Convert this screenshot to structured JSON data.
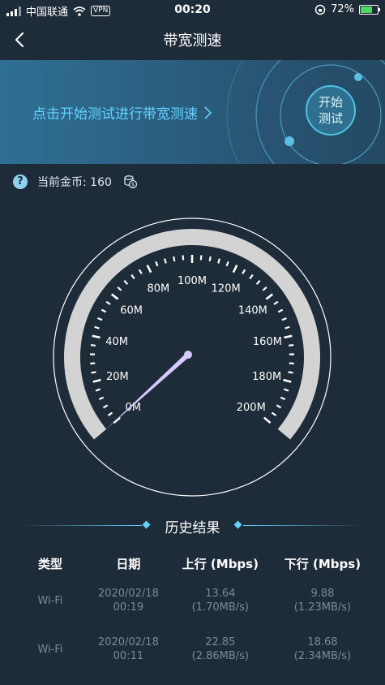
{
  "status_bar": {
    "carrier": "中国联通",
    "vpn": "VPN",
    "time": "00:20",
    "battery_percent": "72%",
    "battery_level": 0.72
  },
  "nav": {
    "title": "带宽测速"
  },
  "banner": {
    "prompt": "点击开始测试进行带宽测速",
    "start_line1": "开始",
    "start_line2": "测试"
  },
  "coins": {
    "label": "当前金币: 160"
  },
  "gauge": {
    "ticks": [
      "0M",
      "20M",
      "40M",
      "60M",
      "80M",
      "100M",
      "120M",
      "140M",
      "160M",
      "180M",
      "200M"
    ],
    "max": 200,
    "value": 0,
    "colors": {
      "arc": "#d3d3d3",
      "needle": "#d6c9ff"
    }
  },
  "history": {
    "title": "历史结果",
    "headers": [
      "类型",
      "日期",
      "上行 (Mbps)",
      "下行 (Mbps)"
    ],
    "rows": [
      {
        "type": "Wi-Fi",
        "date": "2020/02/18",
        "time": "00:19",
        "up": "13.64",
        "up_sub": "(1.70MB/s)",
        "down": "9.88",
        "down_sub": "(1.23MB/s)"
      },
      {
        "type": "Wi-Fi",
        "date": "2020/02/18",
        "time": "00:11",
        "up": "22.85",
        "up_sub": "(2.86MB/s)",
        "down": "18.68",
        "down_sub": "(2.34MB/s)"
      }
    ]
  }
}
